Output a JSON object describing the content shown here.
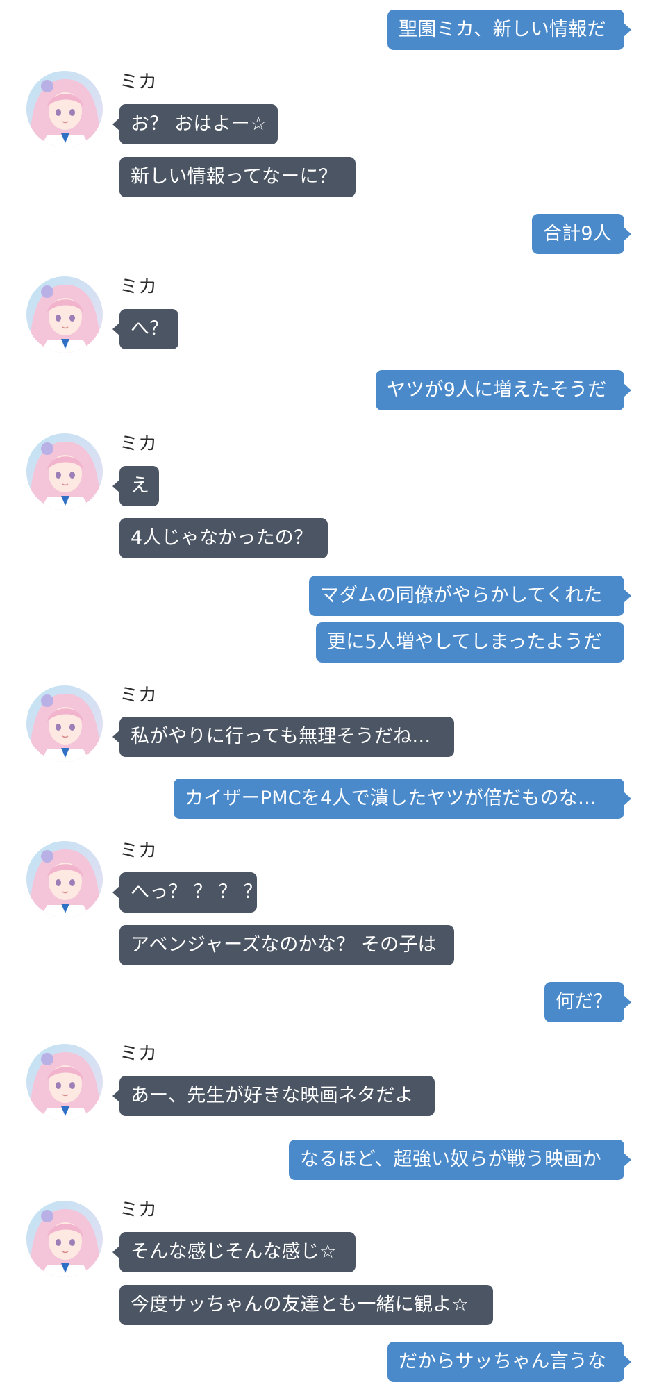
{
  "colors": {
    "sent_bubble": "#4a8acb",
    "received_bubble": "#4b5563",
    "sender_name_text": "#2b2b2b",
    "background": "#ffffff"
  },
  "avatar_icon": "character-avatar-icon",
  "messages": [
    {
      "side": "sent",
      "text": "聖園ミカ、新しい情報だ"
    },
    {
      "side": "received",
      "sender": "ミカ",
      "lines": [
        "お？ おはよー☆",
        "新しい情報ってなーに？"
      ]
    },
    {
      "side": "sent",
      "text": "合計9人"
    },
    {
      "side": "received",
      "sender": "ミカ",
      "lines": [
        "へ？"
      ]
    },
    {
      "side": "sent",
      "text": "ヤツが9人に増えたそうだ"
    },
    {
      "side": "received",
      "sender": "ミカ",
      "lines": [
        "え",
        "4人じゃなかったの？"
      ]
    },
    {
      "side": "sent",
      "text": "マダムの同僚がやらかしてくれた"
    },
    {
      "side": "sent",
      "text": "更に5人増やしてしまったようだ"
    },
    {
      "side": "received",
      "sender": "ミカ",
      "lines": [
        "私がやりに行っても無理そうだね…"
      ]
    },
    {
      "side": "sent",
      "text": "カイザーPMCを4人で潰したヤツが倍だものな…"
    },
    {
      "side": "received",
      "sender": "ミカ",
      "lines": [
        "へっ？ ？ ？ ？",
        "アベンジャーズなのかな？ その子は"
      ]
    },
    {
      "side": "sent",
      "text": "何だ？"
    },
    {
      "side": "received",
      "sender": "ミカ",
      "lines": [
        "あー、先生が好きな映画ネタだよ"
      ]
    },
    {
      "side": "sent",
      "text": "なるほど、超強い奴らが戦う映画か"
    },
    {
      "side": "received",
      "sender": "ミカ",
      "lines": [
        "そんな感じそんな感じ☆",
        "今度サッちゃんの友達とも一緒に観よ☆"
      ]
    },
    {
      "side": "sent",
      "text": "だからサッちゃん言うな"
    }
  ]
}
